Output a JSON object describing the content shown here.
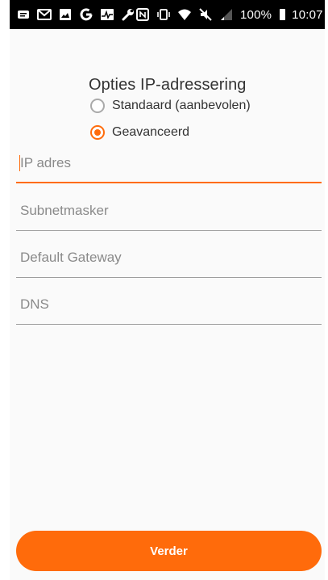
{
  "statusbar": {
    "battery_percent": "100%",
    "time": "10:07",
    "icons_left": [
      "chat-icon",
      "gmail-icon",
      "gallery-icon",
      "google-icon",
      "pulse-app-icon",
      "wrench-icon"
    ],
    "icons_right": [
      "nfc-icon",
      "vibrate-icon",
      "wifi-icon",
      "mute-icon",
      "signal-icon",
      "battery-icon"
    ]
  },
  "page": {
    "title": "Opties IP-adressering",
    "options": [
      {
        "label": "Standaard (aanbevolen)",
        "selected": false
      },
      {
        "label": "Geavanceerd",
        "selected": true
      }
    ],
    "fields": [
      {
        "placeholder": "IP adres",
        "focused": true
      },
      {
        "placeholder": "Subnetmasker",
        "focused": false
      },
      {
        "placeholder": "Default Gateway",
        "focused": false
      },
      {
        "placeholder": "DNS",
        "focused": false
      }
    ],
    "button_label": "Verder"
  },
  "colors": {
    "accent": "#ff6b0b",
    "statusbar": "#000000"
  }
}
